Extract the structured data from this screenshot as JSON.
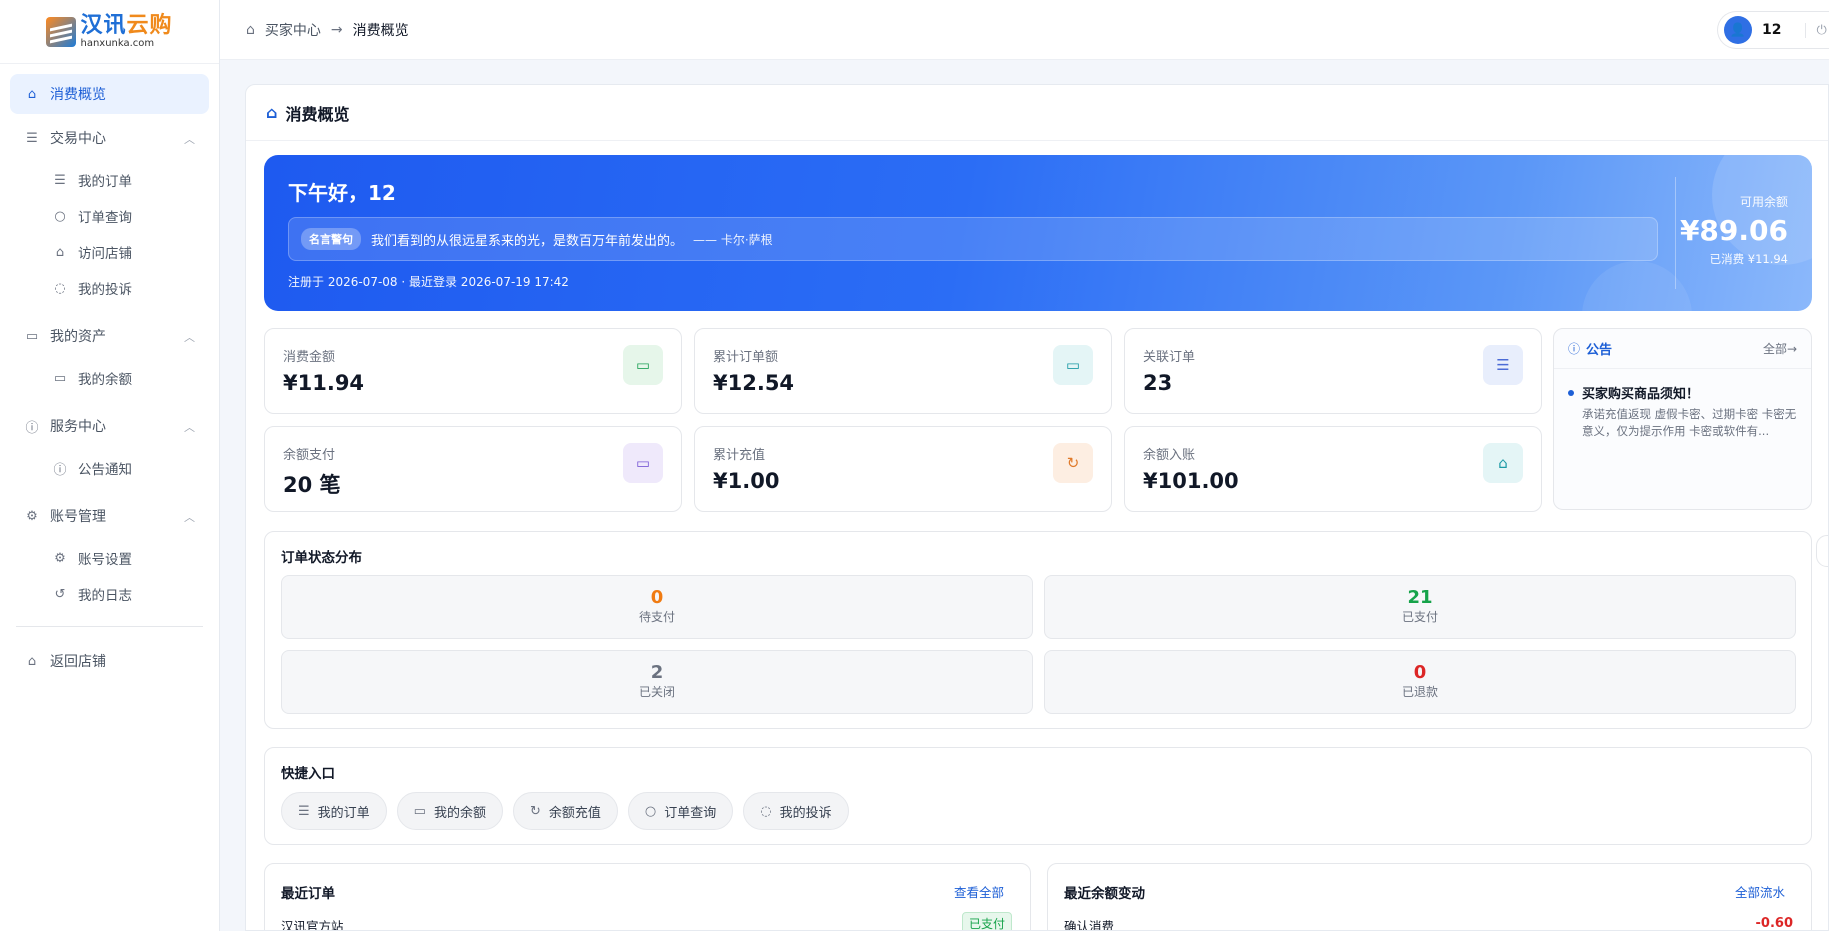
{
  "logo": {
    "cn_main": "汉讯",
    "cn_accent": "云购",
    "domain": "hanxunka.com"
  },
  "sidebar": {
    "overview": "消费概览",
    "groups": [
      {
        "label": "交易中心",
        "items": [
          "我的订单",
          "订单查询",
          "访问店铺",
          "我的投诉"
        ]
      },
      {
        "label": "我的资产",
        "items": [
          "我的余额"
        ]
      },
      {
        "label": "服务中心",
        "items": [
          "公告通知"
        ]
      },
      {
        "label": "账号管理",
        "items": [
          "账号设置",
          "我的日志"
        ]
      }
    ],
    "back": "返回店铺"
  },
  "header": {
    "breadcrumb": {
      "root": "买家中心",
      "current": "消费概览"
    },
    "user": {
      "name": "12"
    }
  },
  "panel": {
    "title": "消费概览"
  },
  "hero": {
    "greeting": "下午好，12",
    "quote_tag": "名言警句",
    "quote_text": "我们看到的从很远星系来的光，是数百万年前发出的。",
    "quote_author": "—— 卡尔·萨根",
    "registration": "注册于 2026-07-08 · 最近登录 2026-07-19 17:42",
    "balance_label": "可用余额",
    "balance_value": "¥89.06",
    "spent": "已消费 ¥11.94"
  },
  "stats": [
    {
      "label": "消费金额",
      "value": "¥11.94",
      "icon": "card-icon",
      "color": "#e6f6ea",
      "fg": "#22a35a"
    },
    {
      "label": "累计订单额",
      "value": "¥12.54",
      "icon": "card-icon",
      "color": "#e4f5f6",
      "fg": "#1c9aa5"
    },
    {
      "label": "关联订单",
      "value": "23",
      "icon": "list-icon",
      "color": "#e8eefc",
      "fg": "#4b6bd6"
    },
    {
      "label": "余额支付",
      "value": "20 笔",
      "icon": "card-icon",
      "color": "#efe9fb",
      "fg": "#7b5cd6"
    },
    {
      "label": "累计充值",
      "value": "¥1.00",
      "icon": "refresh-icon",
      "color": "#fdeee2",
      "fg": "#e07a2a"
    },
    {
      "label": "余额入账",
      "value": "¥101.00",
      "icon": "home-icon",
      "color": "#e4f5f6",
      "fg": "#1c9aa5"
    }
  ],
  "notice": {
    "title": "公告",
    "all_link": "全部→",
    "item_title": "买家购买商品须知！",
    "item_body": "承诺充值返现 虚假卡密、过期卡密 卡密无意义，仅为提示作用 卡密或软件有..."
  },
  "order_status": {
    "title": "订单状态分布",
    "items": [
      {
        "value": "0",
        "label": "待支付",
        "color": "#f07b12"
      },
      {
        "value": "21",
        "label": "已支付",
        "color": "#16a34a"
      },
      {
        "value": "2",
        "label": "已关闭",
        "color": "#6b7280"
      },
      {
        "value": "0",
        "label": "已退款",
        "color": "#dc2626"
      }
    ]
  },
  "quick": {
    "title": "快捷入口",
    "items": [
      {
        "label": "我的订单",
        "icon": "list-icon"
      },
      {
        "label": "我的余额",
        "icon": "card-icon"
      },
      {
        "label": "余额充值",
        "icon": "refresh-icon"
      },
      {
        "label": "订单查询",
        "icon": "search-icon"
      },
      {
        "label": "我的投诉",
        "icon": "message-icon"
      }
    ]
  },
  "recent_orders": {
    "title": "最近订单",
    "link": "查看全部",
    "row_name": "汉讯官方站",
    "row_status": "已支付"
  },
  "balance_changes": {
    "title": "最近余额变动",
    "link": "全部流水",
    "row_name": "确认消费",
    "row_amount": "-0.60"
  }
}
